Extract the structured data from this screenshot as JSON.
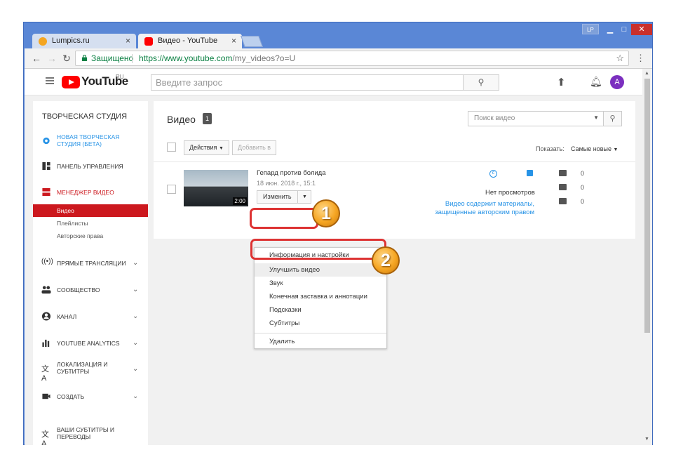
{
  "browser": {
    "tabs": [
      {
        "title": "Lumpics.ru",
        "favicon_color": "#f4a623"
      },
      {
        "title": "Видео - YouTube",
        "favicon_color": "#ff0000"
      }
    ],
    "profile_badge": "LP",
    "address": {
      "secure_label": "Защищено",
      "url_host": "https://www.youtube.com",
      "url_path": "/my_videos?o=U"
    }
  },
  "youtube": {
    "logo_text": "YouTube",
    "logo_region": "RU",
    "search_placeholder": "Введите запрос",
    "avatar_letter": "A"
  },
  "sidebar": {
    "title": "ТВОРЧЕСКАЯ СТУДИЯ",
    "items": [
      {
        "label": "НОВАЯ ТВОРЧЕСКАЯ СТУДИЯ (БЕТА)",
        "icon": "gear-icon",
        "color": "#2793e6"
      },
      {
        "label": "ПАНЕЛЬ УПРАВЛЕНИЯ",
        "icon": "dashboard-icon",
        "color": "#333333"
      },
      {
        "label": "МЕНЕДЖЕР ВИДЕО",
        "icon": "video-manager-icon",
        "color": "#cc181e"
      },
      {
        "label": "ПРЯМЫЕ ТРАНСЛЯЦИИ",
        "icon": "live-icon",
        "color": "#333333"
      },
      {
        "label": "СООБЩЕСТВО",
        "icon": "community-icon",
        "color": "#333333"
      },
      {
        "label": "КАНАЛ",
        "icon": "channel-icon",
        "color": "#333333"
      },
      {
        "label": "YOUTUBE ANALYTICS",
        "icon": "analytics-icon",
        "color": "#333333"
      },
      {
        "label": "ЛОКАЛИЗАЦИЯ И СУБТИТРЫ",
        "icon": "translate-icon",
        "color": "#333333"
      },
      {
        "label": "СОЗДАТЬ",
        "icon": "camera-icon",
        "color": "#333333"
      },
      {
        "label": "ВАШИ СУБТИТРЫ И ПЕРЕВОДЫ",
        "icon": "subtitles-icon",
        "color": "#333333"
      }
    ],
    "subitems": [
      "Видео",
      "Плейлисты",
      "Авторские права"
    ]
  },
  "main": {
    "heading": "Видео",
    "count": "1",
    "video_search_placeholder": "Поиск видео",
    "actions_label": "Действия",
    "add_to_label": "Добавить в",
    "show_label": "Показать:",
    "sort_value": "Самые новые",
    "video": {
      "title": "Гепард против болида",
      "date": "18 июн. 2018 г., 15:1",
      "duration": "2:00",
      "edit_label": "Изменить",
      "views": "Нет просмотров",
      "notice": "Видео содержит материалы, защищенные авторским правом",
      "comments": "0",
      "likes": "0",
      "dislikes": "0"
    }
  },
  "edit_menu": {
    "items": [
      "Информация и настройки",
      "Улучшить видео",
      "Звук",
      "Конечная заставка и аннотации",
      "Подсказки",
      "Субтитры"
    ],
    "delete_label": "Удалить"
  },
  "annotations": {
    "step1": "1",
    "step2": "2",
    "color": "#d33333"
  }
}
